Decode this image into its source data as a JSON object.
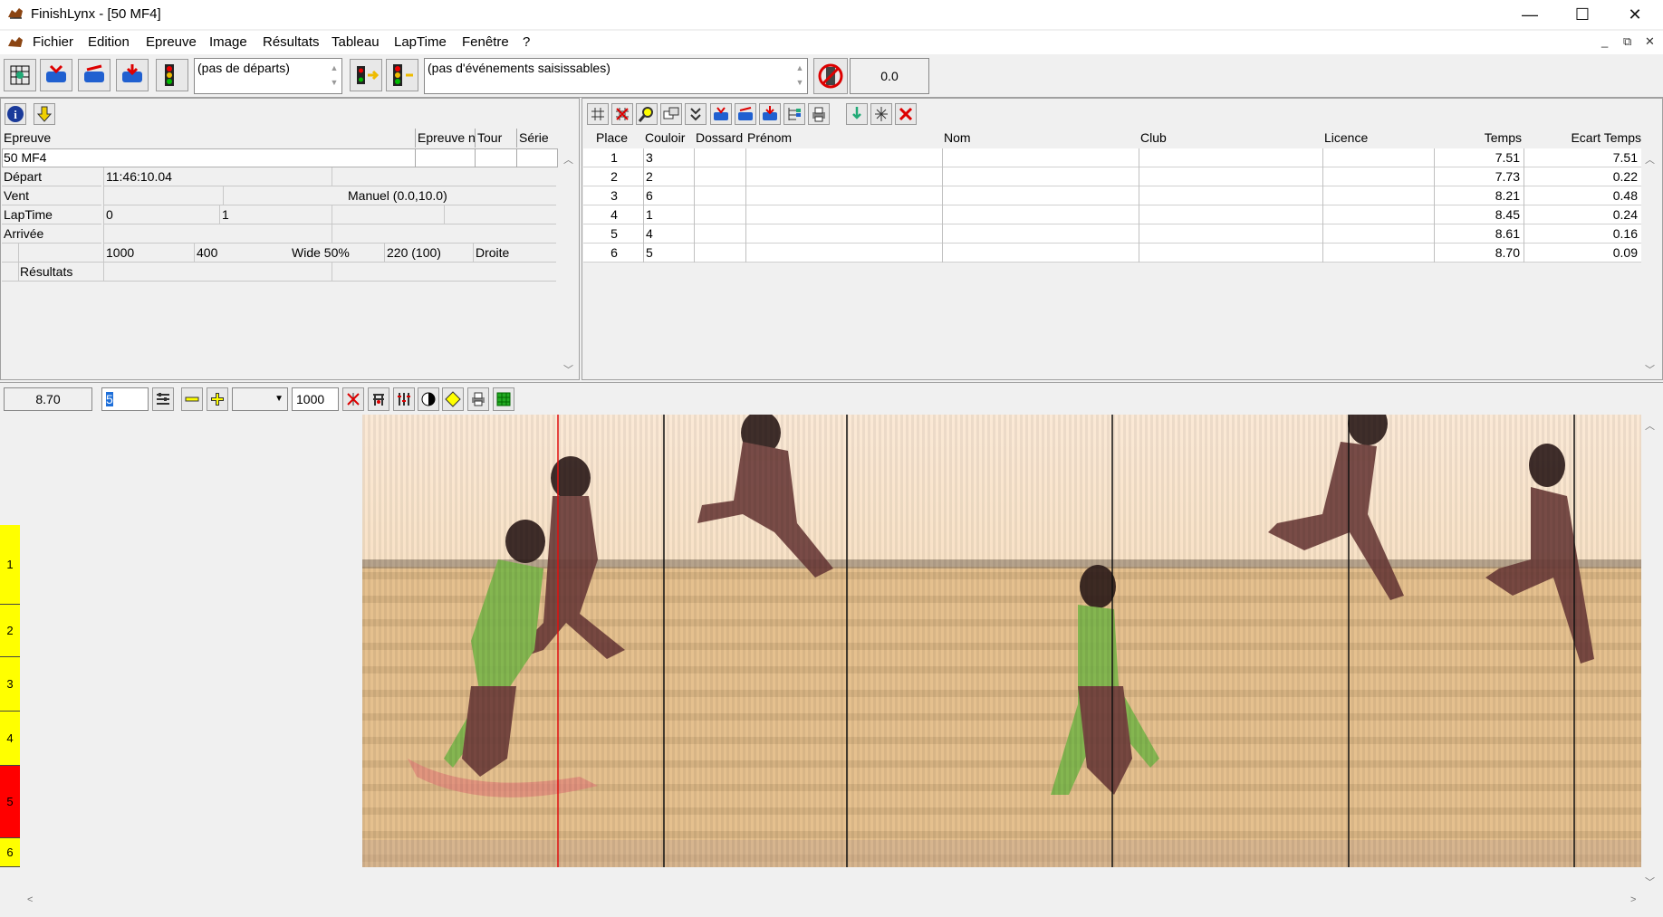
{
  "window": {
    "title": "FinishLynx - [50 MF4]",
    "minimize": "—",
    "maximize": "☐",
    "close": "✕"
  },
  "menu": [
    "Fichier",
    "Edition",
    "Epreuve",
    "Image",
    "Résultats",
    "Tableau",
    "LapTime",
    "Fenêtre",
    "?"
  ],
  "mdi_controls": [
    "_",
    "⧉",
    "✕"
  ],
  "toolbar": {
    "starts_placeholder": "(pas de départs)",
    "events_placeholder": "(pas d'événements saisissables)",
    "wind_value": "0.0"
  },
  "event_panel": {
    "headers": {
      "event": "Epreuve",
      "event_num": "Epreuve n",
      "round": "Tour",
      "heat": "Série"
    },
    "event_name": "50 MF4",
    "start_label": "Départ",
    "start_time": "11:46:10.04",
    "wind_label": "Vent",
    "wind_mode": "Manuel (0.0,10.0)",
    "laptime_label": "LapTime",
    "laptime_a": "0",
    "laptime_b": "1",
    "finish_label": "Arrivée",
    "finish_params": [
      "1000",
      "400",
      "Wide 50%",
      "220  (100)",
      "Droite"
    ],
    "results_label": "Résultats"
  },
  "results_table": {
    "columns": [
      "Place",
      "Couloir",
      "Dossard",
      "Prénom",
      "Nom",
      "Club",
      "Licence",
      "Temps",
      "Ecart Temps"
    ],
    "rows": [
      {
        "place": "1",
        "lane": "3",
        "bib": "",
        "first": "",
        "last": "",
        "club": "",
        "licence": "",
        "time": "7.51",
        "gap": "7.51"
      },
      {
        "place": "2",
        "lane": "2",
        "bib": "",
        "first": "",
        "last": "",
        "club": "",
        "licence": "",
        "time": "7.73",
        "gap": "0.22"
      },
      {
        "place": "3",
        "lane": "6",
        "bib": "",
        "first": "",
        "last": "",
        "club": "",
        "licence": "",
        "time": "8.21",
        "gap": "0.48"
      },
      {
        "place": "4",
        "lane": "1",
        "bib": "",
        "first": "",
        "last": "",
        "club": "",
        "licence": "",
        "time": "8.45",
        "gap": "0.24"
      },
      {
        "place": "5",
        "lane": "4",
        "bib": "",
        "first": "",
        "last": "",
        "club": "",
        "licence": "",
        "time": "8.61",
        "gap": "0.16"
      },
      {
        "place": "6",
        "lane": "5",
        "bib": "",
        "first": "",
        "last": "",
        "club": "",
        "licence": "",
        "time": "8.70",
        "gap": "0.09"
      }
    ]
  },
  "image_toolbar": {
    "cursor_time": "8.70",
    "lane_input": "5",
    "zoom_value": "1000",
    "dropdown_value": ""
  },
  "lanes": [
    {
      "label": "1",
      "color": "#ffff00"
    },
    {
      "label": "2",
      "color": "#ffff00"
    },
    {
      "label": "3",
      "color": "#ffff00"
    },
    {
      "label": "4",
      "color": "#ffff00"
    },
    {
      "label": "5",
      "color": "#ff0000"
    },
    {
      "label": "6",
      "color": "#ffff00"
    }
  ],
  "colors": {
    "accent_red": "#e01010",
    "lane_yellow": "#ffff00",
    "lane_selected": "#ff0000"
  }
}
